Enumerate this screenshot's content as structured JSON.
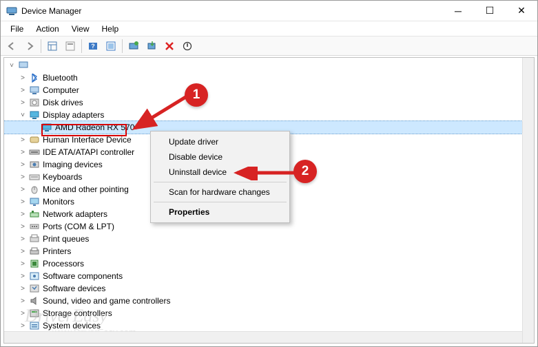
{
  "window": {
    "title": "Device Manager"
  },
  "menubar": [
    "File",
    "Action",
    "View",
    "Help"
  ],
  "root_node": "",
  "categories": [
    {
      "icon": "bluetooth",
      "label": "Bluetooth"
    },
    {
      "icon": "computer",
      "label": "Computer"
    },
    {
      "icon": "disk",
      "label": "Disk drives"
    },
    {
      "icon": "display",
      "label": "Display adapters",
      "expanded": true,
      "children": [
        {
          "icon": "display",
          "label": "AMD Radeon RX 570",
          "selected": true
        }
      ]
    },
    {
      "icon": "hid",
      "label": "Human Interface Device"
    },
    {
      "icon": "ide",
      "label": "IDE ATA/ATAPI controller"
    },
    {
      "icon": "imaging",
      "label": "Imaging devices"
    },
    {
      "icon": "keyboard",
      "label": "Keyboards"
    },
    {
      "icon": "mouse",
      "label": "Mice and other pointing"
    },
    {
      "icon": "monitor",
      "label": "Monitors"
    },
    {
      "icon": "network",
      "label": "Network adapters"
    },
    {
      "icon": "ports",
      "label": "Ports (COM & LPT)"
    },
    {
      "icon": "printq",
      "label": "Print queues"
    },
    {
      "icon": "printer",
      "label": "Printers"
    },
    {
      "icon": "cpu",
      "label": "Processors"
    },
    {
      "icon": "softc",
      "label": "Software components"
    },
    {
      "icon": "softd",
      "label": "Software devices"
    },
    {
      "icon": "sound",
      "label": "Sound, video and game controllers"
    },
    {
      "icon": "storage",
      "label": "Storage controllers"
    },
    {
      "icon": "system",
      "label": "System devices"
    }
  ],
  "context_menu": {
    "items": [
      {
        "label": "Update driver"
      },
      {
        "label": "Disable device"
      },
      {
        "label": "Uninstall device",
        "highlighted": true
      },
      {
        "sep": true
      },
      {
        "label": "Scan for hardware changes"
      },
      {
        "sep": true
      },
      {
        "label": "Properties",
        "bold": true
      }
    ]
  },
  "annotations": {
    "a1": "1",
    "a2": "2"
  },
  "watermark": {
    "main": "DriverEasy",
    "sub": "www.DriverEasy.com"
  }
}
